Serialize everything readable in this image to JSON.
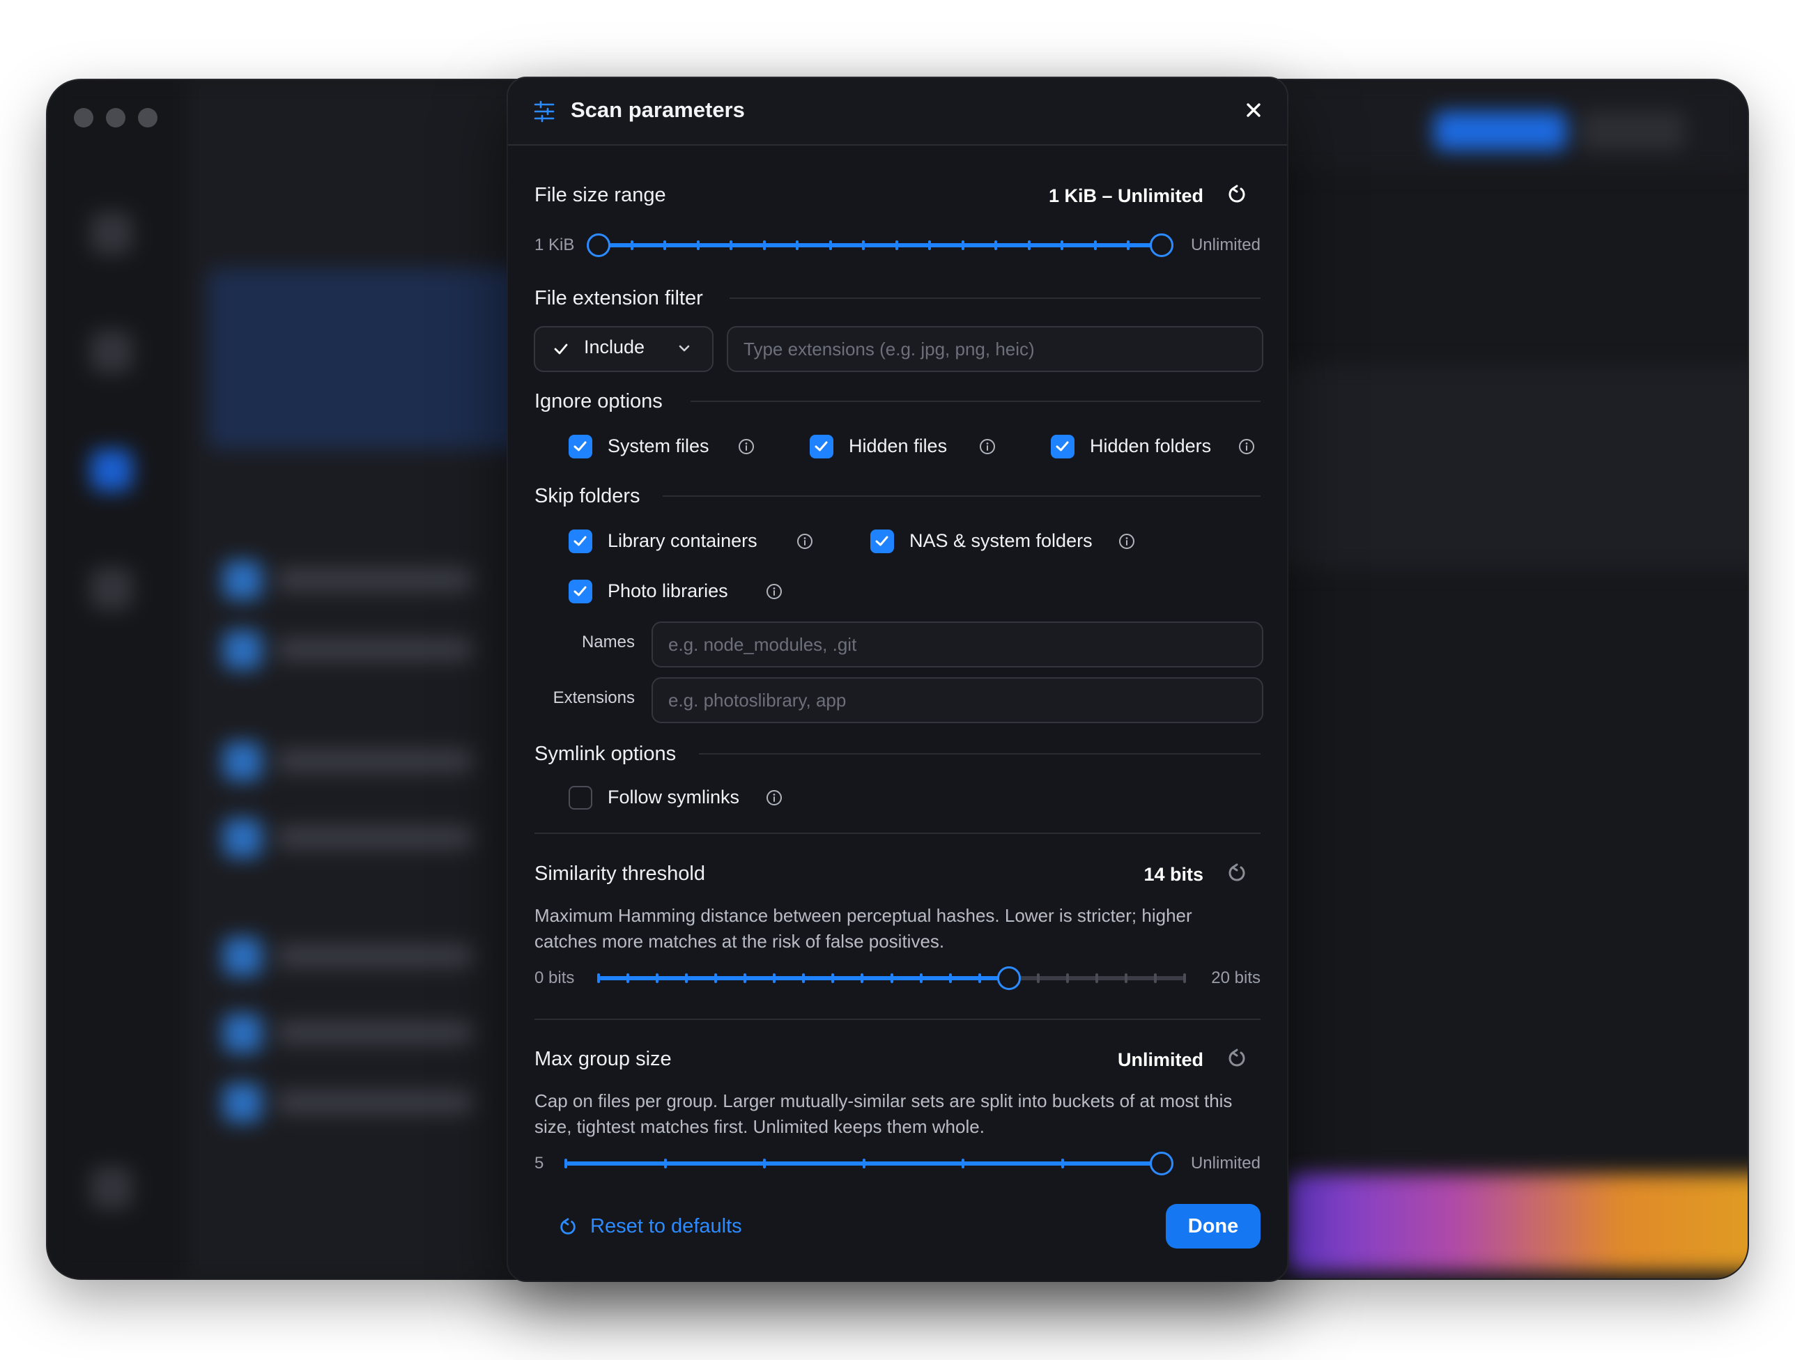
{
  "modal": {
    "title": "Scan parameters",
    "file_size": {
      "label": "File size range",
      "value": "1 KiB – Unlimited",
      "min_label": "1 KiB",
      "max_label": "Unlimited",
      "range_fraction": [
        0.0,
        1.0
      ]
    },
    "extension_filter": {
      "label": "File extension filter",
      "mode": "Include",
      "placeholder": "Type extensions (e.g. jpg, png, heic)",
      "value": ""
    },
    "ignore": {
      "label": "Ignore options",
      "items": [
        {
          "label": "System files",
          "checked": true
        },
        {
          "label": "Hidden files",
          "checked": true
        },
        {
          "label": "Hidden folders",
          "checked": true
        }
      ]
    },
    "skip": {
      "label": "Skip folders",
      "items": [
        {
          "label": "Library containers",
          "checked": true
        },
        {
          "label": "NAS & system folders",
          "checked": true
        },
        {
          "label": "Photo libraries",
          "checked": true
        }
      ],
      "names_label": "Names",
      "names_placeholder": "e.g. node_modules, .git",
      "ext_label": "Extensions",
      "ext_placeholder": "e.g. photoslibrary, app"
    },
    "symlink": {
      "label": "Symlink options",
      "follow_label": "Follow symlinks",
      "checked": false
    },
    "similarity": {
      "label": "Similarity threshold",
      "value": "14 bits",
      "description": "Maximum Hamming distance between perceptual hashes. Lower is stricter; higher catches more matches at the risk of false positives.",
      "min_label": "0 bits",
      "max_label": "20 bits",
      "current": 14,
      "max": 20
    },
    "max_group": {
      "label": "Max group size",
      "value": "Unlimited",
      "description": "Cap on files per group. Larger mutually-similar sets are split into buckets of at most this size, tightest matches first. Unlimited keeps them whole.",
      "min_label": "5",
      "max_label": "Unlimited",
      "fraction": 1.0
    },
    "footer": {
      "reset_label": "Reset to defaults",
      "done_label": "Done"
    }
  },
  "colors": {
    "accent": "#1f82ff",
    "modal_bg": "#15161b",
    "text": "#ffffff",
    "muted": "#9a9ea8"
  }
}
